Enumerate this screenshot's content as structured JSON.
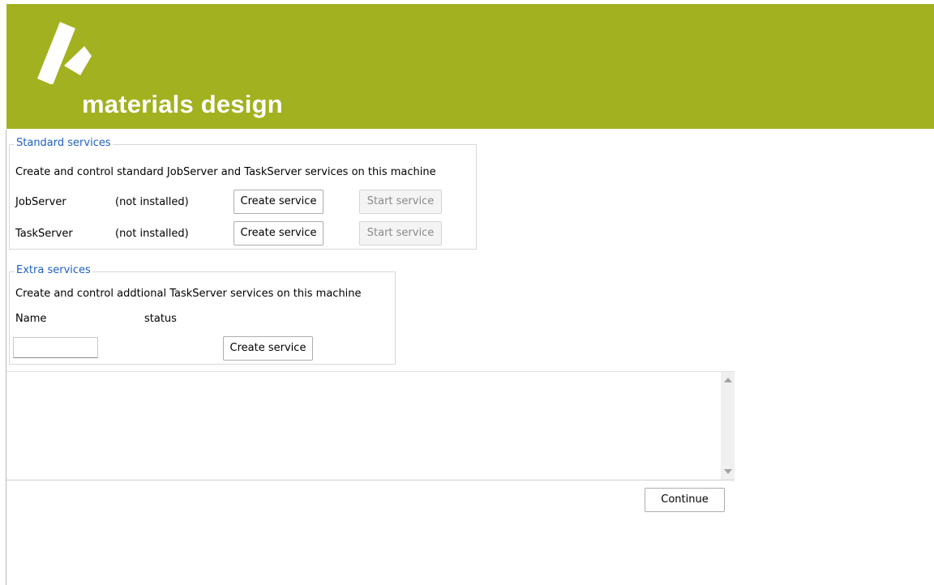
{
  "brand": {
    "name": "materials design",
    "background_color": "#a2b11f",
    "text_color": "#ffffff",
    "logo_icon": "materials-design-logo-icon"
  },
  "standard_services": {
    "legend": "Standard services",
    "description": "Create and control standard JobServer and TaskServer services on this machine",
    "rows": [
      {
        "name": "JobServer",
        "status": "(not installed)",
        "create_label": "Create service",
        "start_label": "Start service",
        "start_enabled": false
      },
      {
        "name": "TaskServer",
        "status": "(not installed)",
        "create_label": "Create service",
        "start_label": "Start service",
        "start_enabled": false
      }
    ]
  },
  "extra_services": {
    "legend": "Extra services",
    "description": "Create and control addtional TaskServer services on this machine",
    "name_header": "Name",
    "status_header": "status",
    "name_input_value": "",
    "create_label": "Create service"
  },
  "log": {
    "text": ""
  },
  "footer": {
    "continue_label": "Continue"
  },
  "colors": {
    "legend_text": "#1f5fc4",
    "disabled_text": "#8a8a8a"
  }
}
